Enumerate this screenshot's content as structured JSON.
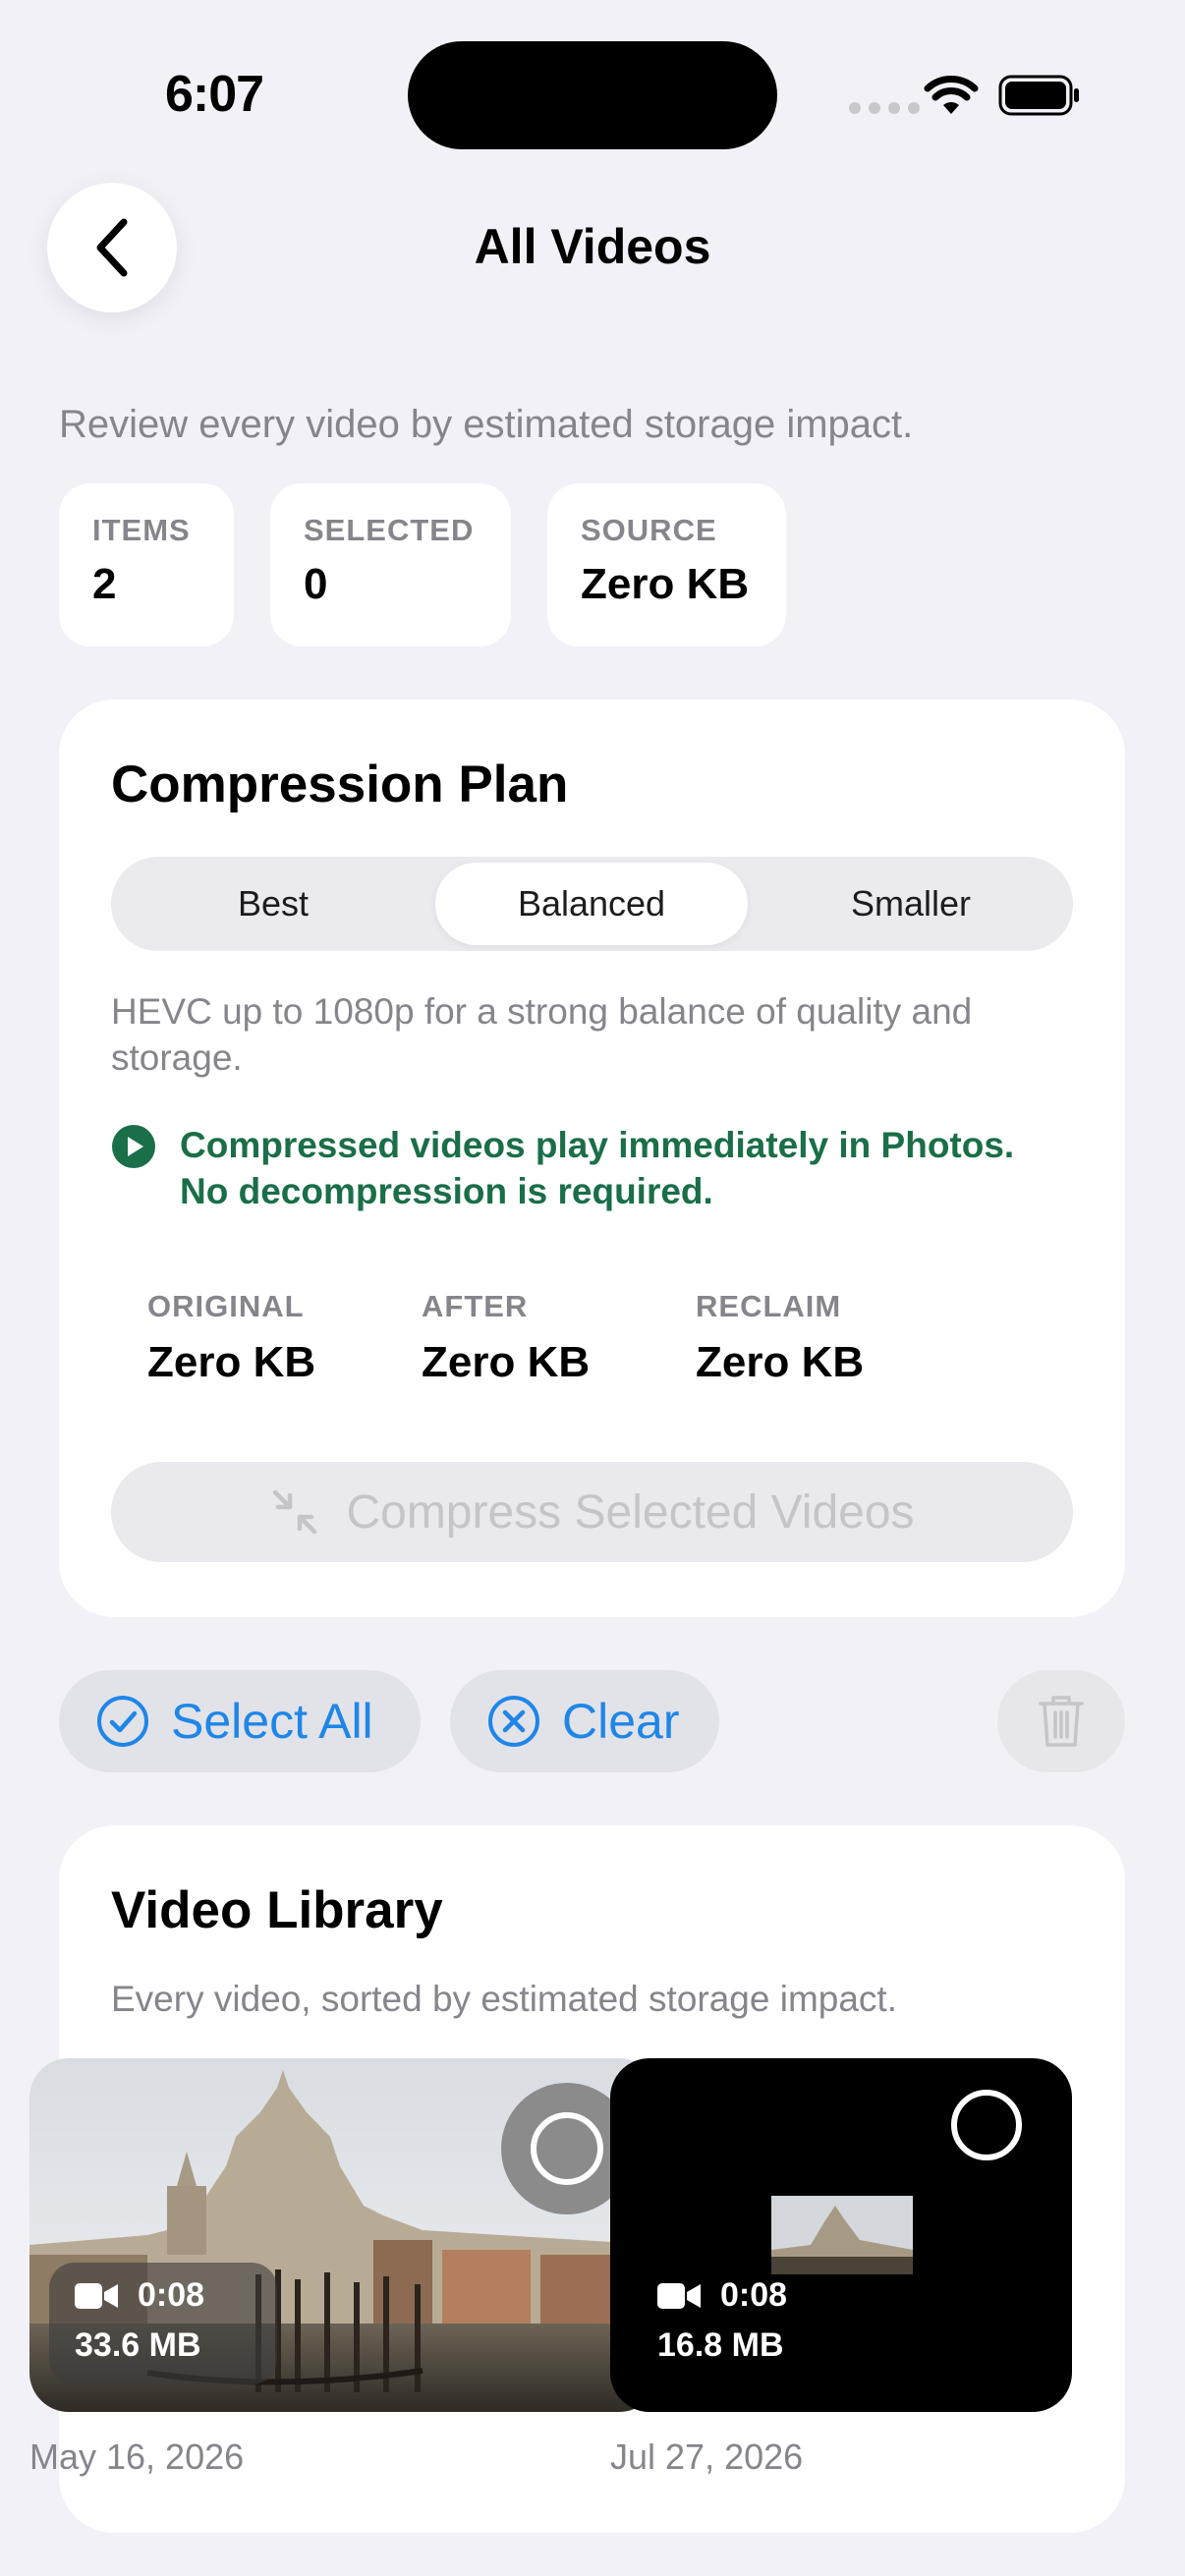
{
  "status_bar": {
    "time": "6:07"
  },
  "nav": {
    "title": "All Videos"
  },
  "subtitle": "Review every video by estimated storage impact.",
  "stats": [
    {
      "label": "ITEMS",
      "value": "2"
    },
    {
      "label": "SELECTED",
      "value": "0"
    },
    {
      "label": "SOURCE",
      "value": "Zero KB"
    }
  ],
  "compression_plan": {
    "title": "Compression Plan",
    "segments": [
      {
        "label": "Best"
      },
      {
        "label": "Balanced"
      },
      {
        "label": "Smaller"
      }
    ],
    "selected_segment": "Balanced",
    "description": "HEVC up to 1080p for a strong balance of quality and storage.",
    "note": "Compressed videos play immediately in Photos. No decompression is required.",
    "metrics": [
      {
        "label": "ORIGINAL",
        "value": "Zero KB"
      },
      {
        "label": "AFTER",
        "value": "Zero KB"
      },
      {
        "label": "RECLAIM",
        "value": "Zero KB"
      }
    ],
    "compress_button": "Compress Selected Videos"
  },
  "actions": {
    "select_all": "Select All",
    "clear": "Clear"
  },
  "library": {
    "title": "Video Library",
    "subtitle": "Every video, sorted by estimated storage impact.",
    "videos": [
      {
        "duration": "0:08",
        "size": "33.6 MB",
        "date": "May 16, 2026"
      },
      {
        "duration": "0:08",
        "size": "16.8 MB",
        "date": "Jul 27, 2026"
      }
    ]
  },
  "colors": {
    "accent": "#1f86e8",
    "note_green": "#1a6e48",
    "background": "#f2f1f7"
  }
}
